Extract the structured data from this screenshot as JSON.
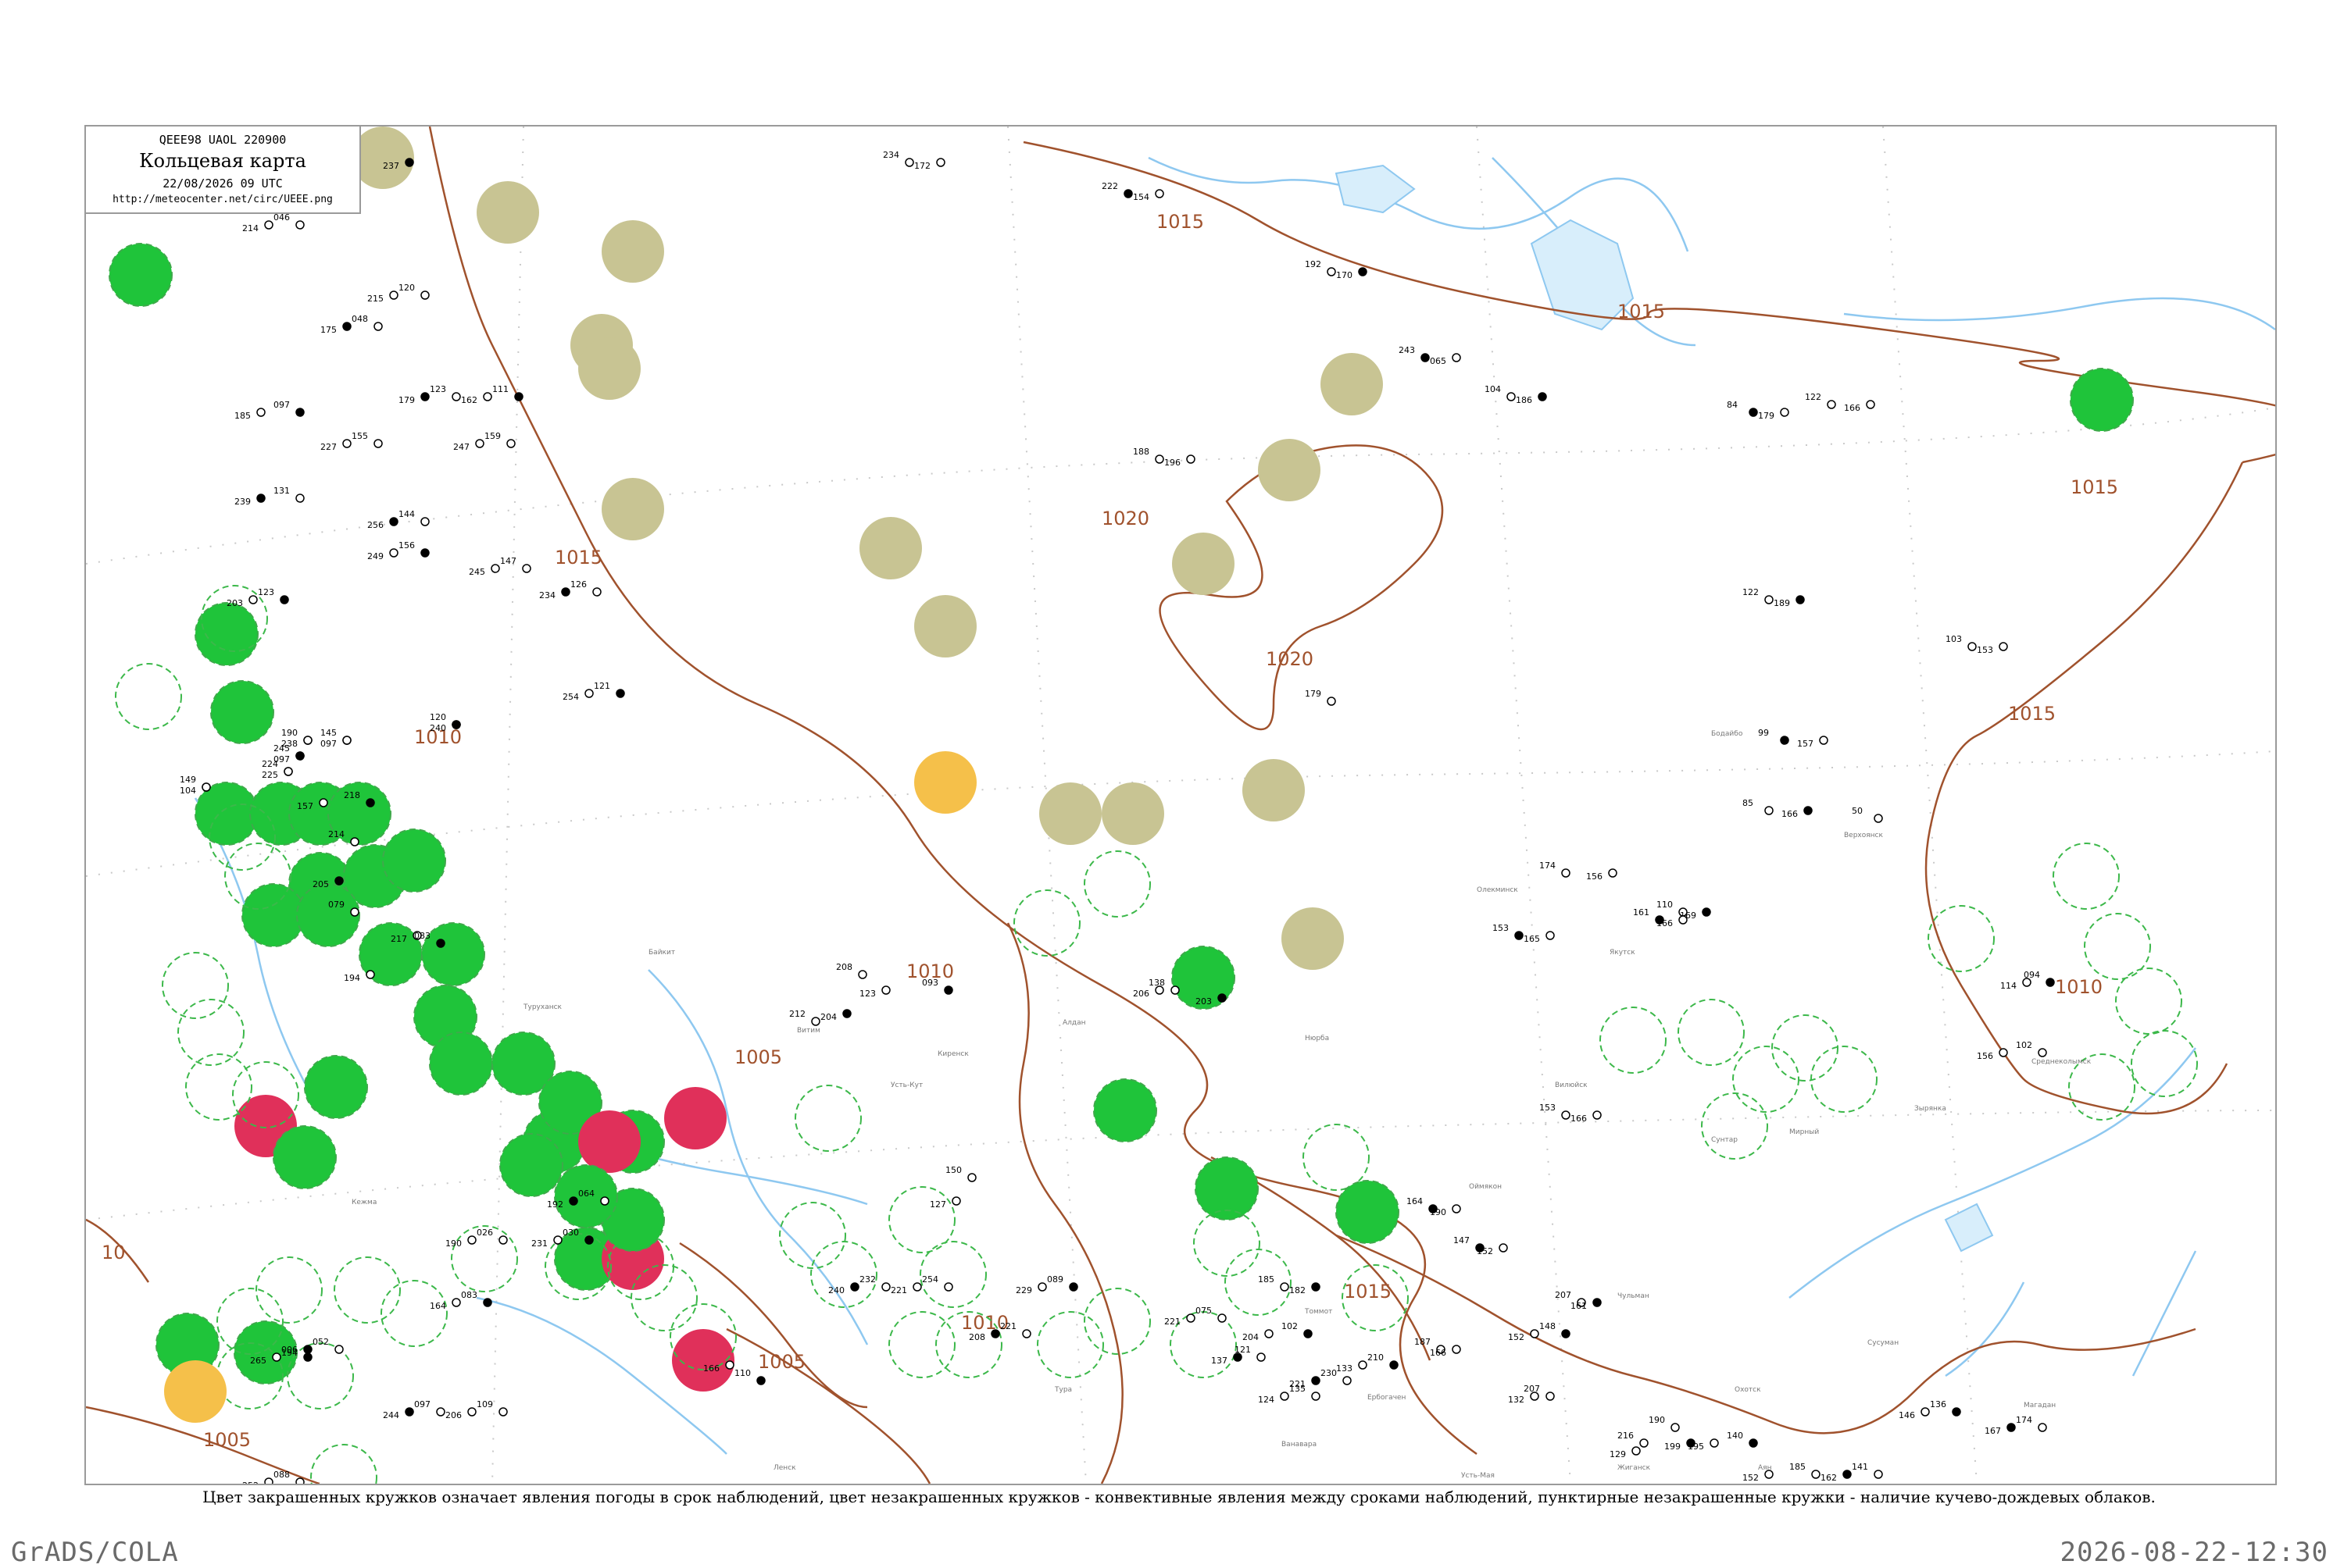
{
  "header": {
    "code_line": "QEEE98  UAOL  220900",
    "title": "Кольцевая карта",
    "datetime": "22/08/2026 09 UTC",
    "url": "http://meteocenter.net/circ/UEEE.png"
  },
  "caption": "Цвет закрашенных кружков означает явления погоды в срок наблюдений, цвет незакрашенных кружков - конвективные явления между сроками наблюдений, пунктирные незакрашенные кружки - наличие кучево-дождевых облаков.",
  "footer": {
    "left": "GrADS/COLA",
    "right": "2026-08-22-12:30"
  },
  "colors": {
    "frame": "#9a9a9a",
    "isobar": "#a0522d",
    "river": "#8ec8f0",
    "green_fill": "#1fc43a",
    "olive_fill": "#c8c493",
    "red_fill": "#e0305a",
    "orange_fill": "#f5c04a",
    "dashed_ring": "#3cb84a"
  },
  "isobar_labels": [
    "1015",
    "1015",
    "1015",
    "1020",
    "1020",
    "1010",
    "1010",
    "1005",
    "1005",
    "1015",
    "1015",
    "1010",
    "1010",
    "1015",
    "1005",
    "10"
  ],
  "station_names": [
    "Бодайбо",
    "Олекминск",
    "Якутск",
    "Верхоянск",
    "Оймякон",
    "Алдан",
    "Витим",
    "Киренск",
    "Усть-Кут",
    "Нюрба",
    "Вилюйск",
    "Сунтар",
    "Мирный",
    "Ербогачен",
    "Тура",
    "Ванавара",
    "Жиганск",
    "Чульман",
    "Томмот",
    "Усть-Мая",
    "Зырянка",
    "Среднеколымск",
    "Сусуман",
    "Магадан",
    "Охотск",
    "Аян",
    "Ленск",
    "Туруханск",
    "Байкит",
    "Кежма"
  ],
  "station_values": [
    "190",
    "097",
    "120",
    "104",
    "224",
    "097",
    "218",
    "157",
    "214",
    "205",
    "079",
    "217",
    "083",
    "194",
    "212",
    "204",
    "208",
    "123",
    "093",
    "206",
    "138",
    "203",
    "150",
    "127",
    "147",
    "152",
    "207",
    "161",
    "153",
    "166",
    "164",
    "190",
    "185",
    "182",
    "187",
    "166",
    "153",
    "165",
    "110",
    "169",
    "174",
    "156",
    "161",
    "166",
    "179",
    "237",
    "234",
    "172",
    "222",
    "154",
    "192",
    "170",
    "188",
    "196",
    "243",
    "065",
    "104",
    "186",
    "122",
    "166",
    "84",
    "179",
    "122",
    "189",
    "103",
    "153",
    "99",
    "157",
    "85",
    "166",
    "50",
    "114",
    "094",
    "156",
    "102",
    "167",
    "174",
    "195",
    "140",
    "152",
    "185",
    "162",
    "141",
    "146",
    "136",
    "129",
    "216",
    "199",
    "190",
    "152",
    "148",
    "132",
    "207",
    "221",
    "230",
    "133",
    "210",
    "124",
    "135",
    "137",
    "121",
    "204",
    "102",
    "221",
    "075",
    "208",
    "221",
    "229",
    "089",
    "221",
    "254",
    "240",
    "232",
    "166",
    "110",
    "206",
    "109",
    "244",
    "097",
    "265",
    "006",
    "252",
    "088",
    "194",
    "052",
    "164",
    "083",
    "190",
    "026",
    "192",
    "064",
    "231",
    "030",
    "214",
    "046",
    "175",
    "048",
    "185",
    "097",
    "227",
    "155",
    "239",
    "131",
    "203",
    "123",
    "215",
    "120",
    "179",
    "123",
    "162",
    "111",
    "247",
    "159",
    "256",
    "144",
    "249",
    "156",
    "245",
    "147",
    "234",
    "126",
    "254",
    "121",
    "238",
    "145",
    "240",
    "149",
    "225",
    "245"
  ]
}
